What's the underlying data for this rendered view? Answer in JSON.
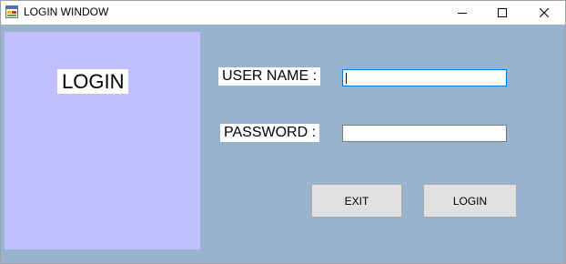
{
  "window": {
    "title": "LOGIN WINDOW",
    "icon": "app-form-icon",
    "controls": [
      "minimize-icon",
      "maximize-icon",
      "close-icon"
    ]
  },
  "panel": {
    "heading": "LOGIN",
    "color": "#c1bfff"
  },
  "form": {
    "username_label": "USER NAME :",
    "username_value": "",
    "password_label": "PASSWORD :",
    "password_value": ""
  },
  "buttons": {
    "exit_label": "EXIT",
    "login_label": "LOGIN"
  },
  "colors": {
    "client_background": "#99b3cf",
    "focused_border": "#0078d7",
    "button_face": "#e1e1e1"
  }
}
